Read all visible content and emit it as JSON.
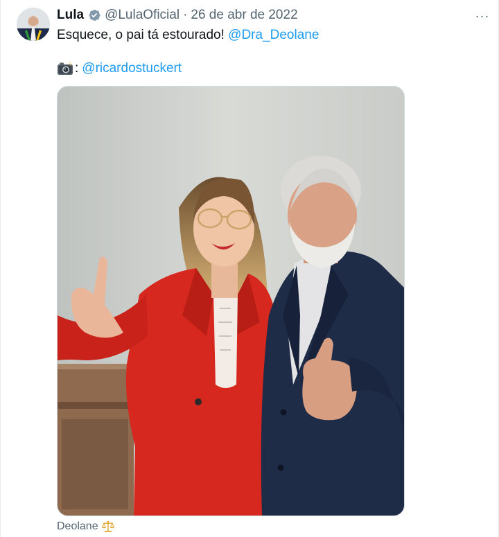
{
  "tweet": {
    "author_name": "Lula",
    "author_handle": "@LulaOficial",
    "separator": "·",
    "date": "26 de abr de 2022",
    "text": "Esquece, o pai tá estourado! ",
    "text_mention": "@Dra_Deolane",
    "credit_separator": ":",
    "credit_mention": "@ricardostuckert",
    "more_label": "···",
    "tag_text": "Deolane"
  },
  "icons": {
    "verified": "verified-badge-icon",
    "camera": "camera-with-flash-emoji",
    "scale": "balance-scale-emoji",
    "more": "more-options-icon"
  },
  "colors": {
    "link": "#1d9bf0",
    "secondary_text": "#536471",
    "primary_text": "#0f1419",
    "verified_badge": "#829aab"
  }
}
